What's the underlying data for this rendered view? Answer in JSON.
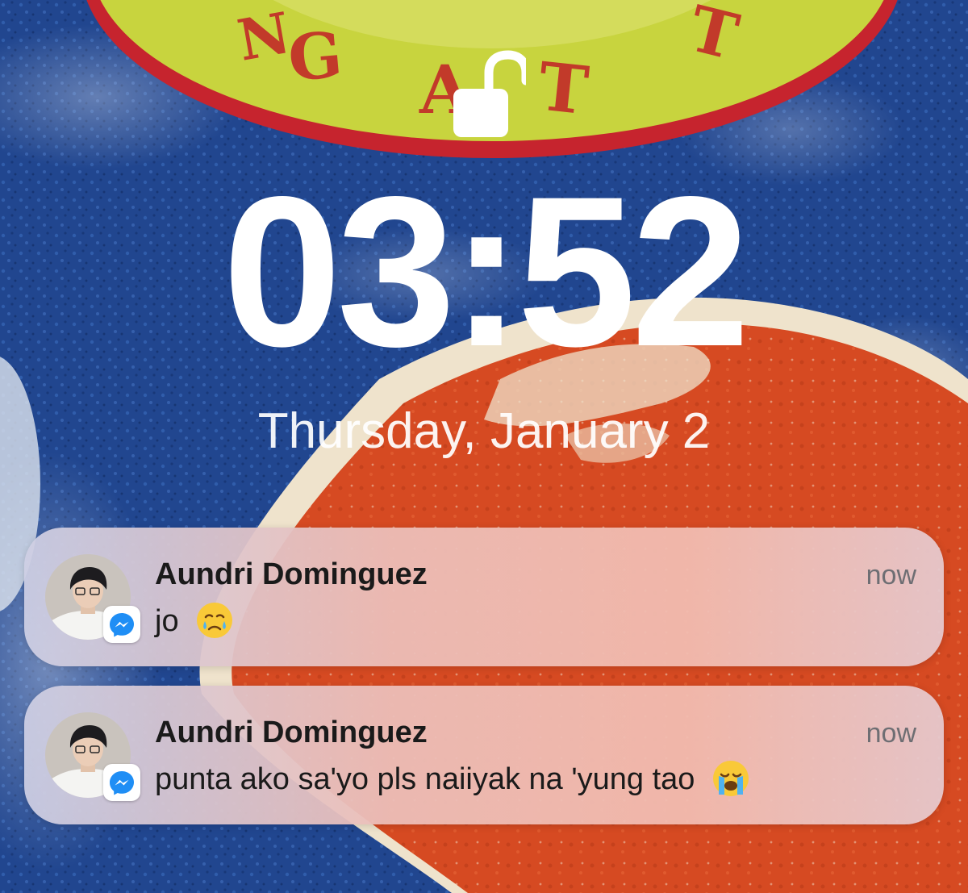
{
  "lock_screen": {
    "lock_icon": "unlocked-padlock-icon",
    "time": "03:52",
    "date": "Thursday, January 2"
  },
  "wallpaper": {
    "ring_text": "NG AT T",
    "colors": {
      "sky_blue": "#21468f",
      "ring_green": "#c6d33c",
      "ring_red": "#d83a2a",
      "orange": "#d94b22",
      "cream": "#efe6d3"
    }
  },
  "notifications": [
    {
      "sender": "Aundri Dominguez",
      "time": "now",
      "message": "jo",
      "emoji": "face-holding-back-tears-emoji",
      "app_icon": "messenger-icon"
    },
    {
      "sender": "Aundri Dominguez",
      "time": "now",
      "message": "punta ako sa'yo pls naiiyak na 'yung tao",
      "emoji": "loudly-crying-face-emoji",
      "app_icon": "messenger-icon"
    }
  ]
}
